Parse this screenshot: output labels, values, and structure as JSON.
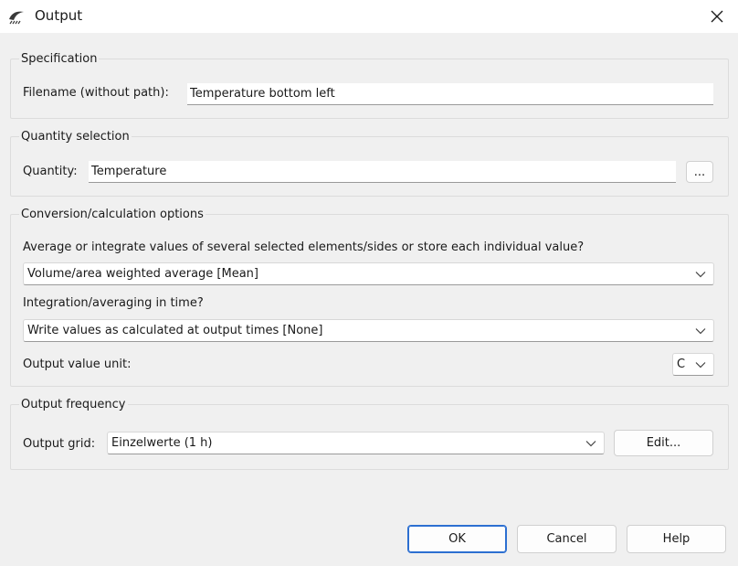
{
  "window": {
    "title": "Output",
    "icon": "fan-blade-icon",
    "close_icon": "close-icon"
  },
  "specification": {
    "title": "Specification",
    "filename_label": "Filename (without path):",
    "filename_value": "Temperature bottom left"
  },
  "quantity": {
    "title": "Quantity selection",
    "label": "Quantity:",
    "value": "Temperature",
    "browse_label": "..."
  },
  "conversion": {
    "title": "Conversion/calculation options",
    "average_question": "Average or integrate values of several selected elements/sides or store each individual value?",
    "average_selected": "Volume/area weighted average [Mean]",
    "time_question": "Integration/averaging in time?",
    "time_selected": "Write values as calculated at output times [None]",
    "unit_label": "Output value unit:",
    "unit_selected": "C"
  },
  "frequency": {
    "title": "Output frequency",
    "grid_label": "Output grid:",
    "grid_selected": "Einzelwerte (1 h)",
    "edit_label": "Edit..."
  },
  "buttons": {
    "ok": "OK",
    "cancel": "Cancel",
    "help": "Help"
  },
  "colors": {
    "accent": "#2c6fd1",
    "background": "#f0f0f0",
    "field": "#ffffff"
  }
}
